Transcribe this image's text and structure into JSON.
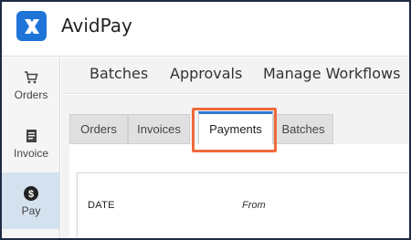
{
  "app": {
    "title": "AvidPay",
    "logo_icon": "x-logo-icon",
    "brand_color": "#1f74d8"
  },
  "sidebar": {
    "items": [
      {
        "label": "Orders",
        "icon": "cart-icon",
        "active": false
      },
      {
        "label": "Invoice",
        "icon": "document-icon",
        "active": false
      },
      {
        "label": "Pay",
        "icon": "dollar-icon",
        "active": true
      }
    ]
  },
  "topnav": {
    "items": [
      {
        "label": "Batches"
      },
      {
        "label": "Approvals"
      },
      {
        "label": "Manage Workflows"
      }
    ]
  },
  "tabs": {
    "items": [
      {
        "label": "Orders",
        "active": false
      },
      {
        "label": "Invoices",
        "active": false
      },
      {
        "label": "Payments",
        "active": true
      },
      {
        "label": "Batches",
        "active": false
      }
    ],
    "highlight_color": "#ee6a3d",
    "active_accent": "#2f7bd3"
  },
  "filters": {
    "date_label": "DATE",
    "from_label": "From"
  }
}
